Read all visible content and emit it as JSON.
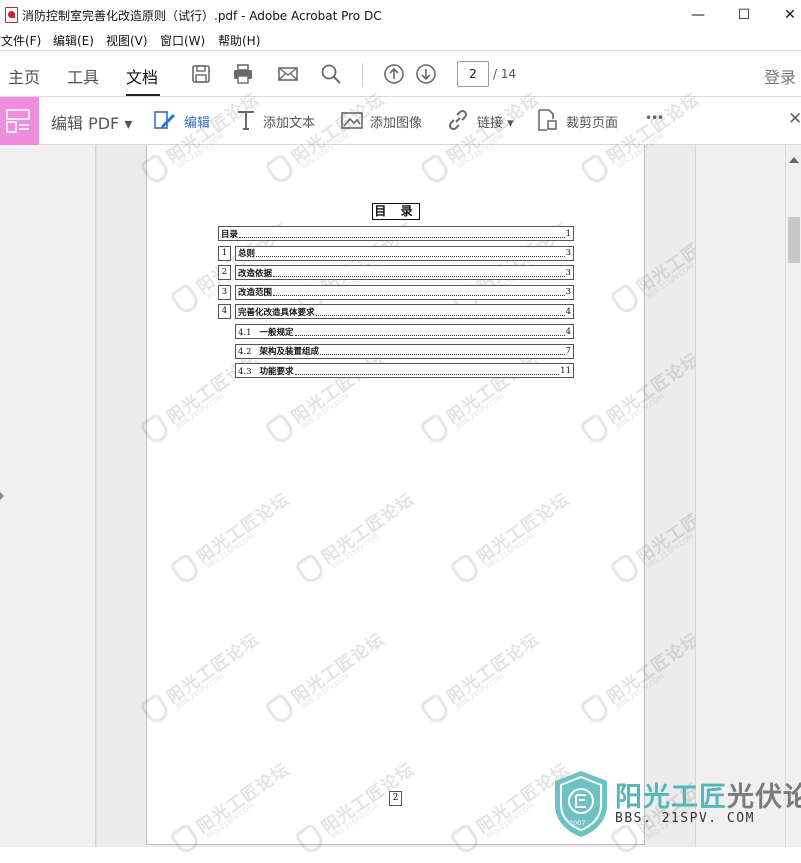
{
  "window": {
    "title": "消防控制室完善化改造原则（试行）.pdf - Adobe Acrobat Pro DC",
    "minimize": "—",
    "maximize": "☐",
    "close": "✕"
  },
  "menu": [
    "文件(F)",
    "编辑(E)",
    "视图(V)",
    "窗口(W)",
    "帮助(H)"
  ],
  "nav": {
    "tabs": [
      "主页",
      "工具",
      "文档"
    ],
    "active_tab": "文档",
    "current_page": "2",
    "total_pages": "/ 14",
    "login": "登录"
  },
  "edit_toolbar": {
    "edit_pdf": "编辑 PDF ▾",
    "edit": "编辑",
    "add_text": "添加文本",
    "add_image": "添加图像",
    "link": "链接 ▾",
    "crop": "裁剪页面",
    "more": "•••",
    "close": "✕"
  },
  "document": {
    "toc_title": "目 录",
    "toc": [
      {
        "num": "",
        "label": "目录",
        "page": "1"
      },
      {
        "num": "1",
        "label": "总则",
        "page": "3"
      },
      {
        "num": "2",
        "label": "改造依据",
        "page": "3"
      },
      {
        "num": "3",
        "label": "改造范围",
        "page": "3"
      },
      {
        "num": "4",
        "label": "完善化改造具体要求",
        "page": "4"
      },
      {
        "num": "4.1",
        "label": "一般规定",
        "page": "4"
      },
      {
        "num": "4.2",
        "label": "架构及装置组成",
        "page": "7"
      },
      {
        "num": "4.3",
        "label": "功能要求",
        "page": "11"
      }
    ],
    "footer_page": "2",
    "watermark_text": "阳光工匠论坛",
    "watermark_sub": "BBS.21SPV.COM"
  },
  "branding": {
    "name_a": "阳光工匠",
    "name_b": "光伏论坛",
    "url": "BBS. 21SPV. COM",
    "year": "2007"
  }
}
